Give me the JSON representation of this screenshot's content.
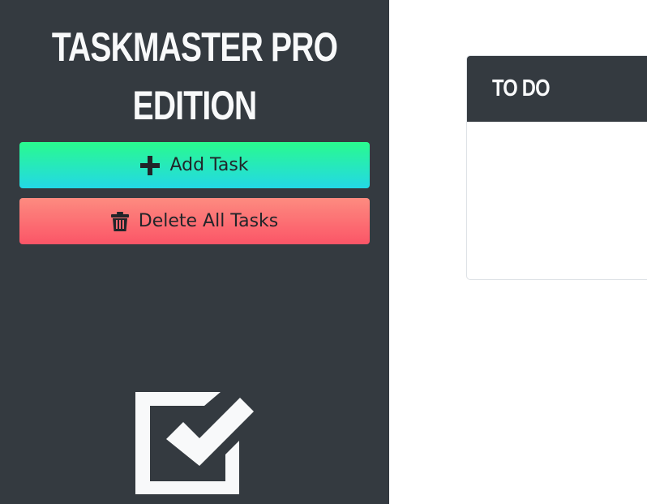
{
  "sidebar": {
    "title_line1": "TASKMASTER PRO",
    "title_line2": "EDITION",
    "add_button_label": "Add Task",
    "add_button_icon": "plus-icon",
    "delete_button_label": "Delete All Tasks",
    "delete_button_icon": "trash-icon",
    "logo_icon": "checkbox-checked-icon"
  },
  "board": {
    "columns": [
      {
        "title": "TO DO",
        "tasks": []
      }
    ]
  },
  "colors": {
    "sidebar_bg": "#343a40",
    "add_gradient": [
      "#2afa8e",
      "#23d8e6"
    ],
    "delete_gradient": [
      "#fd8b80",
      "#fb5567"
    ],
    "text_light": "#f8f9fa"
  }
}
